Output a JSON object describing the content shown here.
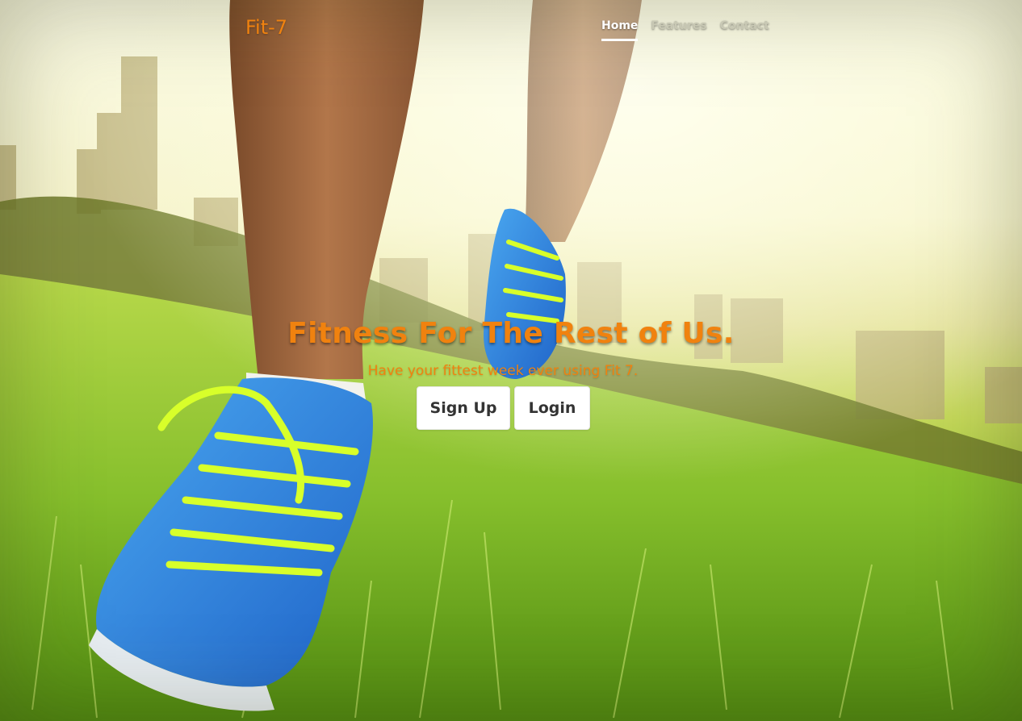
{
  "brand": "Fit-7",
  "nav": {
    "items": [
      {
        "label": "Home",
        "active": true
      },
      {
        "label": "Features",
        "active": false
      },
      {
        "label": "Contact",
        "active": false
      }
    ]
  },
  "hero": {
    "headline": "Fitness For The Rest of Us.",
    "tagline": "Have your fittest week ever using Fit 7.",
    "signup_label": "Sign Up",
    "login_label": "Login"
  },
  "colors": {
    "accent": "#f0820f",
    "button_bg": "#ffffff",
    "nav_active": "#ffffff",
    "nav_inactive": "#c8c8b4"
  }
}
